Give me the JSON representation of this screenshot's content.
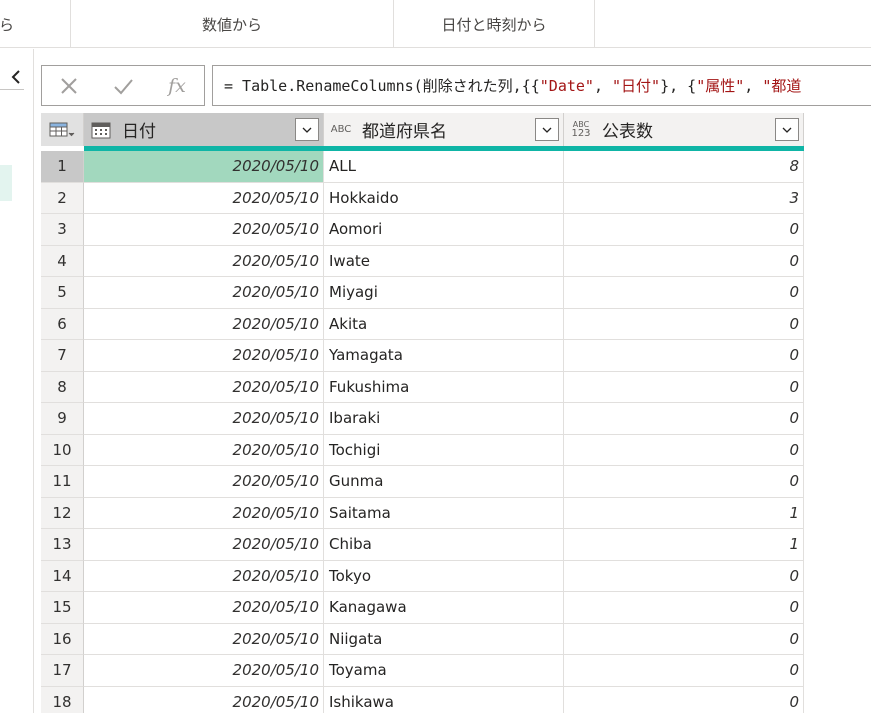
{
  "ribbon": {
    "groups": [
      {
        "label": "から"
      },
      {
        "label": "数値から"
      },
      {
        "label": "日付と時刻から"
      }
    ]
  },
  "formula_bar": {
    "cancel_icon": "x-icon",
    "commit_icon": "check-icon",
    "fx_label": "fx",
    "formula_prefix": "= Table.RenameColumns(削除された列,{{",
    "s1": "\"Date\"",
    "c1": ", ",
    "s2": "\"日付\"",
    "c2": "}, {",
    "s3": "\"属性\"",
    "c3": ", ",
    "s4": "\"都道"
  },
  "grid": {
    "columns": [
      {
        "name": "日付",
        "type_icon": "calendar-icon"
      },
      {
        "name": "都道府県名",
        "type_icon": "text-type-icon",
        "type_label": "ABC"
      },
      {
        "name": "公表数",
        "type_icon": "any-type-icon",
        "type_label_top": "ABC",
        "type_label_bottom": "123"
      }
    ],
    "rows": [
      {
        "n": "1",
        "date": "2020/05/10",
        "pref": "ALL",
        "value": "8"
      },
      {
        "n": "2",
        "date": "2020/05/10",
        "pref": "Hokkaido",
        "value": "3"
      },
      {
        "n": "3",
        "date": "2020/05/10",
        "pref": "Aomori",
        "value": "0"
      },
      {
        "n": "4",
        "date": "2020/05/10",
        "pref": "Iwate",
        "value": "0"
      },
      {
        "n": "5",
        "date": "2020/05/10",
        "pref": "Miyagi",
        "value": "0"
      },
      {
        "n": "6",
        "date": "2020/05/10",
        "pref": "Akita",
        "value": "0"
      },
      {
        "n": "7",
        "date": "2020/05/10",
        "pref": "Yamagata",
        "value": "0"
      },
      {
        "n": "8",
        "date": "2020/05/10",
        "pref": "Fukushima",
        "value": "0"
      },
      {
        "n": "9",
        "date": "2020/05/10",
        "pref": "Ibaraki",
        "value": "0"
      },
      {
        "n": "10",
        "date": "2020/05/10",
        "pref": "Tochigi",
        "value": "0"
      },
      {
        "n": "11",
        "date": "2020/05/10",
        "pref": "Gunma",
        "value": "0"
      },
      {
        "n": "12",
        "date": "2020/05/10",
        "pref": "Saitama",
        "value": "1"
      },
      {
        "n": "13",
        "date": "2020/05/10",
        "pref": "Chiba",
        "value": "1"
      },
      {
        "n": "14",
        "date": "2020/05/10",
        "pref": "Tokyo",
        "value": "0"
      },
      {
        "n": "15",
        "date": "2020/05/10",
        "pref": "Kanagawa",
        "value": "0"
      },
      {
        "n": "16",
        "date": "2020/05/10",
        "pref": "Niigata",
        "value": "0"
      },
      {
        "n": "17",
        "date": "2020/05/10",
        "pref": "Toyama",
        "value": "0"
      },
      {
        "n": "18",
        "date": "2020/05/10",
        "pref": "Ishikawa",
        "value": "0"
      }
    ]
  },
  "colors": {
    "quality_bar": "#0fb5a6",
    "selected_cell": "#a2d8be",
    "formula_string": "#a31515"
  }
}
